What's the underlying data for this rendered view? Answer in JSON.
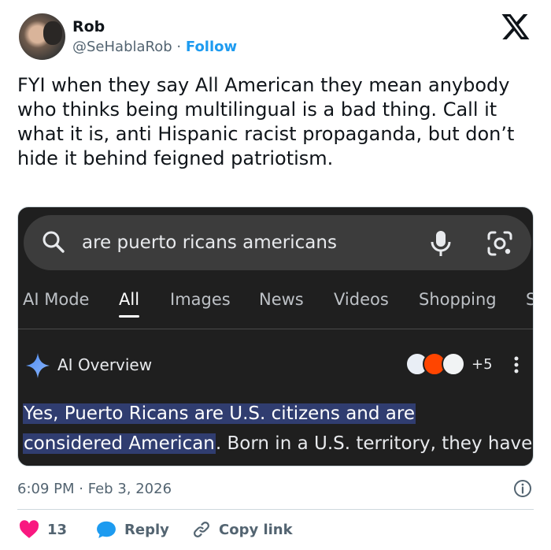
{
  "author": {
    "name": "Rob",
    "handle": "@SeHablaRob",
    "separator": "·",
    "follow_label": "Follow"
  },
  "tweet": {
    "text": "FYI when they say All American they mean anybody who thinks being multilingual is a bad thing. Call it what it is, anti Hispanic racist propaganda, but don’t hide it behind feigned patriotism."
  },
  "screenshot": {
    "search_query": "are puerto ricans americans",
    "tabs": [
      {
        "label": "AI Mode"
      },
      {
        "label": "All"
      },
      {
        "label": "Images"
      },
      {
        "label": "News"
      },
      {
        "label": "Videos"
      },
      {
        "label": "Shopping"
      },
      {
        "label": "S"
      }
    ],
    "active_tab": "All",
    "ai_overview_label": "AI Overview",
    "sources_more": "+5",
    "overview_highlight_1": "Yes, Puerto Ricans are U.S. citizens and are",
    "overview_highlight_2": "considered American",
    "overview_rest": ". Born in a U.S. territory, they have",
    "colors": {
      "background": "#1f1f1f",
      "searchbar": "#3c3c3c",
      "highlight": "#303d70"
    }
  },
  "meta": {
    "time": "6:09 PM",
    "separator": "·",
    "date": "Feb 3, 2026"
  },
  "actions": {
    "like_count": "13",
    "reply_label": "Reply",
    "copy_label": "Copy link"
  },
  "colors": {
    "accent": "#1d9bf0",
    "like": "#f91880",
    "secondary_text": "#536471"
  },
  "icons": [
    "x-logo-icon",
    "search-icon",
    "mic-icon",
    "lens-icon",
    "sparkle-icon",
    "kebab-icon",
    "info-icon",
    "heart-icon",
    "reply-bubble-icon",
    "link-icon"
  ]
}
